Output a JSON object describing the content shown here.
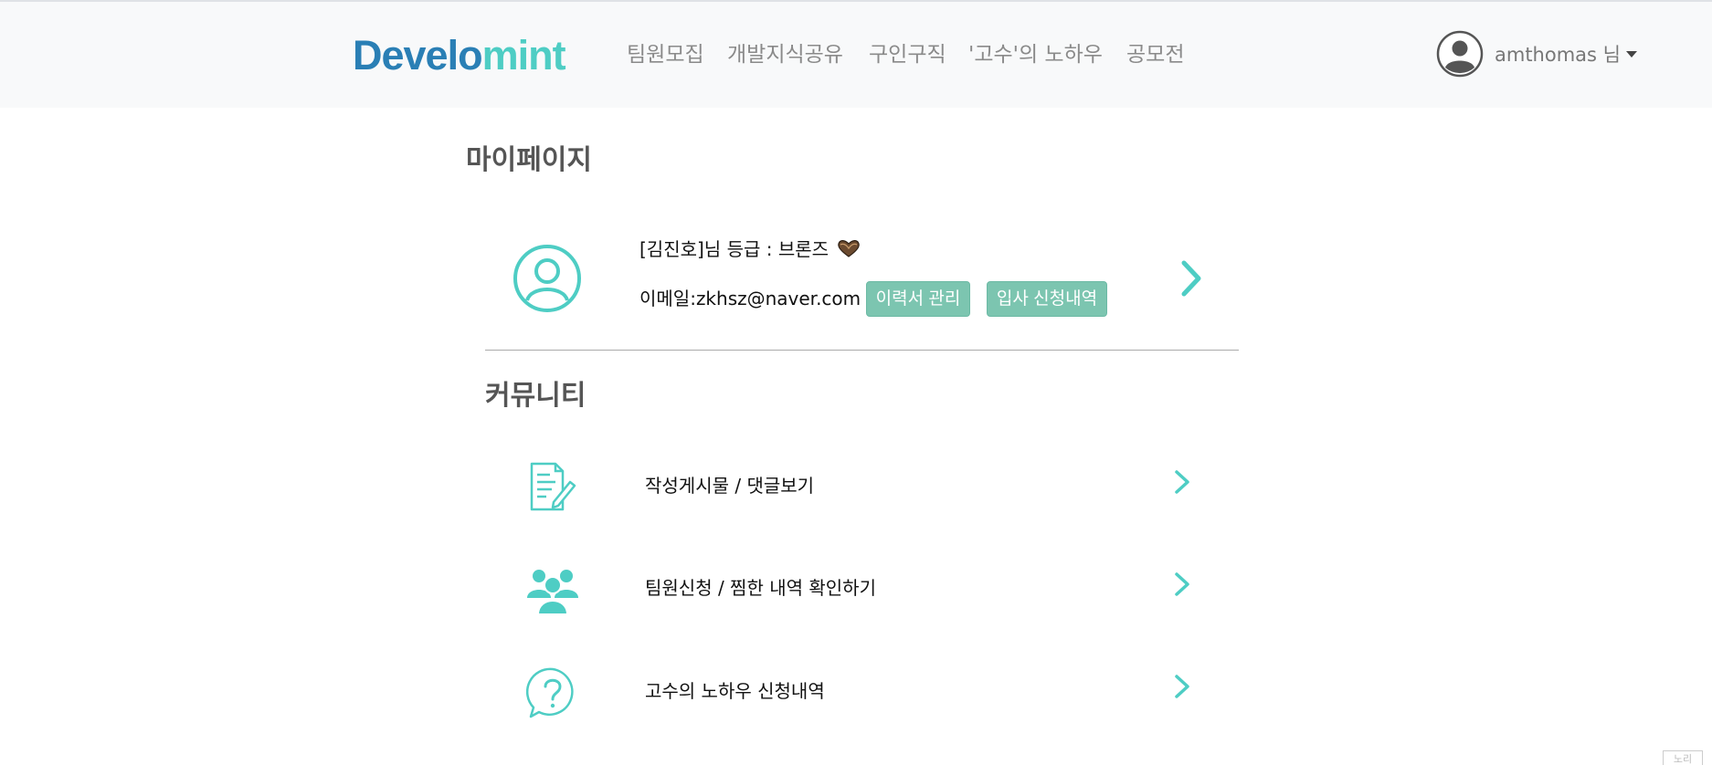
{
  "header": {
    "logo_part1": "Develo",
    "logo_part2": "mint",
    "nav": [
      "팀원모집",
      "개발지식공유",
      "구인구직",
      "'고수'의 노하우",
      "공모전"
    ],
    "user_name": "amthomas 님"
  },
  "main": {
    "title": "마이페이지",
    "profile": {
      "grade_text": "[김진호]님 등급 : 브론즈",
      "email_text": "이메일:zkhsz@naver.com",
      "resume_button": "이력서 관리",
      "applications_button": "입사 신청내역"
    },
    "community": {
      "title": "커뮤니티",
      "items": [
        {
          "label": "작성게시물 / 댓글보기",
          "icon": "document-edit-icon"
        },
        {
          "label": "팀원신청 / 찜한 내역 확인하기",
          "icon": "group-icon"
        },
        {
          "label": "고수의 노하우 신청내역",
          "icon": "question-bubble-icon"
        }
      ]
    }
  },
  "footer": {
    "corner_label": "노리"
  },
  "colors": {
    "accent": "#4ecdc4",
    "logo_blue": "#2a7fb5",
    "button": "#7cc5b0"
  }
}
